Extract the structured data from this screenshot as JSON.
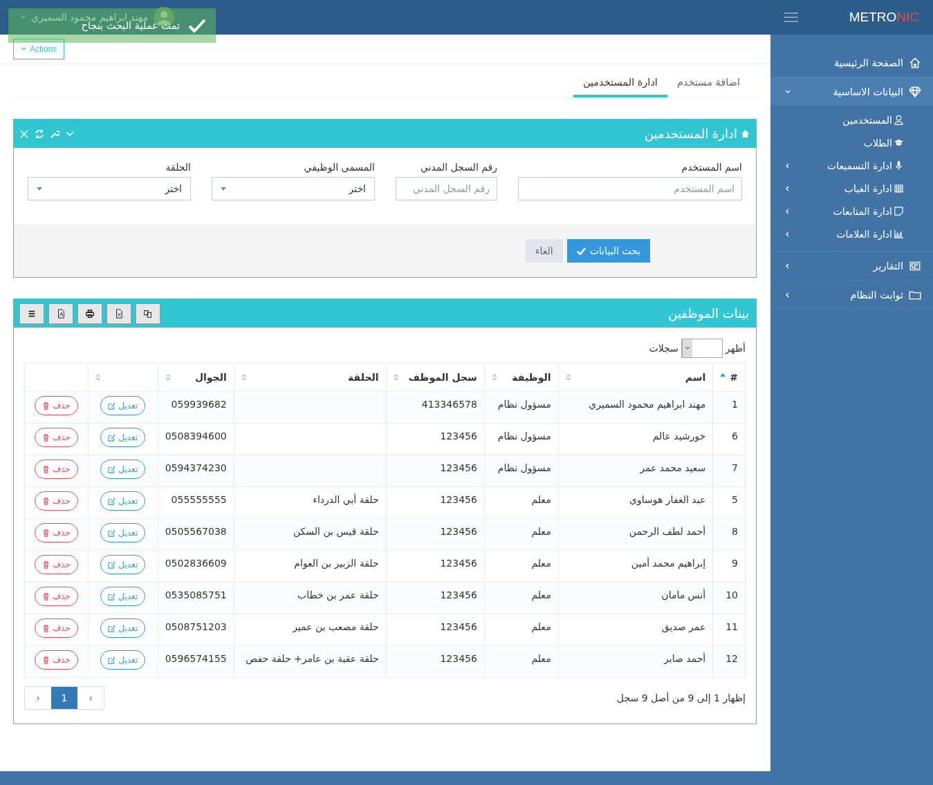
{
  "header": {
    "logo": {
      "text": "METRO",
      "accent": "NIC"
    },
    "user": {
      "name": "مهند ابراهيم محمود السميري"
    }
  },
  "toast": {
    "message": "تمت عملية البحث بنجاح"
  },
  "sidebar": {
    "items": [
      {
        "label": "الصفحة الرئيسية",
        "has_children": false
      },
      {
        "label": "البيانات الاساسية",
        "expanded": true,
        "has_children": true,
        "children": [
          {
            "label": "المستخدمين",
            "has_children": false
          },
          {
            "label": "الطلاب",
            "has_children": false
          },
          {
            "label": "ادارة التسميعات",
            "has_children": true
          },
          {
            "label": "ادارة الغياب",
            "has_children": true
          },
          {
            "label": "ادارة المتابعات",
            "has_children": true
          },
          {
            "label": "ادارة العلامات",
            "has_children": true
          }
        ]
      },
      {
        "label": "التقارير",
        "expanded": false,
        "has_children": true
      },
      {
        "label": "ثوابت النظام",
        "expanded": false,
        "has_children": true
      }
    ]
  },
  "actions_button": "Actions",
  "tabs": [
    {
      "label": "اضافة مستخدم",
      "selected": false
    },
    {
      "label": "ادارة المستخدمين",
      "selected": true
    }
  ],
  "search_panel": {
    "title": "ادارة المستخدمين",
    "fields": [
      {
        "kind": "input",
        "label": "اسم المستخدم",
        "placeholder": "اسم المستخدم"
      },
      {
        "kind": "input",
        "label": "رقم السجل المدني",
        "placeholder": "رقم السجل المدني"
      },
      {
        "kind": "select",
        "label": "المسمى الوظيفي",
        "value": "اختر"
      },
      {
        "kind": "select",
        "label": "الحلقة",
        "value": "اختر"
      }
    ],
    "buttons": [
      {
        "kind": "primary",
        "label": "بحث البيانات"
      },
      {
        "kind": "default",
        "label": "الغاء"
      }
    ]
  },
  "table_panel": {
    "title": "بينات الموظفين",
    "length": {
      "before": "أظهر",
      "after": "سجلات"
    },
    "table": {
      "columns": [
        {
          "label": "#",
          "sortable": true,
          "sorted": true
        },
        {
          "label": "اسم",
          "sortable": true,
          "sorted": false
        },
        {
          "label": "الوظيفة",
          "sortable": true,
          "sorted": false
        },
        {
          "label": "سجل الموظف",
          "sortable": true,
          "sorted": false
        },
        {
          "label": "الحلقة",
          "sortable": true,
          "sorted": false
        },
        {
          "label": "الجوال",
          "sortable": true,
          "sorted": false
        },
        {
          "sortable": true,
          "sorted": false
        },
        {
          "sortable": false
        }
      ],
      "rows": [
        {
          "id": "1",
          "name": "مهند ابراهيم محمود السميري",
          "job": "مسؤول نظام",
          "record": "413346578",
          "circle": "",
          "mobile": "059939682",
          "edit": "تعديل",
          "delete": "حذف"
        },
        {
          "id": "6",
          "name": "خورشيد عالم",
          "job": "مسؤول نظام",
          "record": "123456",
          "circle": "",
          "mobile": "0508394600",
          "edit": "تعديل",
          "delete": "حذف"
        },
        {
          "id": "7",
          "name": "سعيد محمد عمر",
          "job": "مسؤول نظام",
          "record": "123456",
          "circle": "",
          "mobile": "0594374230",
          "edit": "تعديل",
          "delete": "حذف"
        },
        {
          "id": "5",
          "name": "عبد الغفار هوساوي",
          "job": "معلم",
          "record": "123456",
          "circle": "حلقة أبي الدرداء",
          "mobile": "055555555",
          "edit": "تعديل",
          "delete": "حذف"
        },
        {
          "id": "8",
          "name": "أحمد لطف الرحمن",
          "job": "معلم",
          "record": "123456",
          "circle": "حلقة قيس بن السكن",
          "mobile": "0505567038",
          "edit": "تعديل",
          "delete": "حذف"
        },
        {
          "id": "9",
          "name": "إبراهيم محمد أمين",
          "job": "معلم",
          "record": "123456",
          "circle": "حلقة الزبير بن العوام",
          "mobile": "0502836609",
          "edit": "تعديل",
          "delete": "حذف"
        },
        {
          "id": "10",
          "name": "أنس مامان",
          "job": "معلم",
          "record": "123456",
          "circle": "حلقة عمر بن خطاب",
          "mobile": "0535085751",
          "edit": "تعديل",
          "delete": "حذف"
        },
        {
          "id": "11",
          "name": "عمر صديق",
          "job": "معلم",
          "record": "123456",
          "circle": "حلقة مصعب بن عمير",
          "mobile": "0508751203",
          "edit": "تعديل",
          "delete": "حذف"
        },
        {
          "id": "12",
          "name": "أحمد صابر",
          "job": "معلم",
          "record": "123456",
          "circle": "حلقة عقبة بن عامر+ حلقة حفص",
          "mobile": "0596574155",
          "edit": "تعديل",
          "delete": "حذف"
        }
      ]
    },
    "info": "إظهار 1 إلى 9 من أصل 9 سجل",
    "pagination": [
      {
        "label": "›",
        "selected": false
      },
      {
        "label": "1",
        "selected": true
      },
      {
        "label": "‹",
        "selected": false
      }
    ]
  }
}
